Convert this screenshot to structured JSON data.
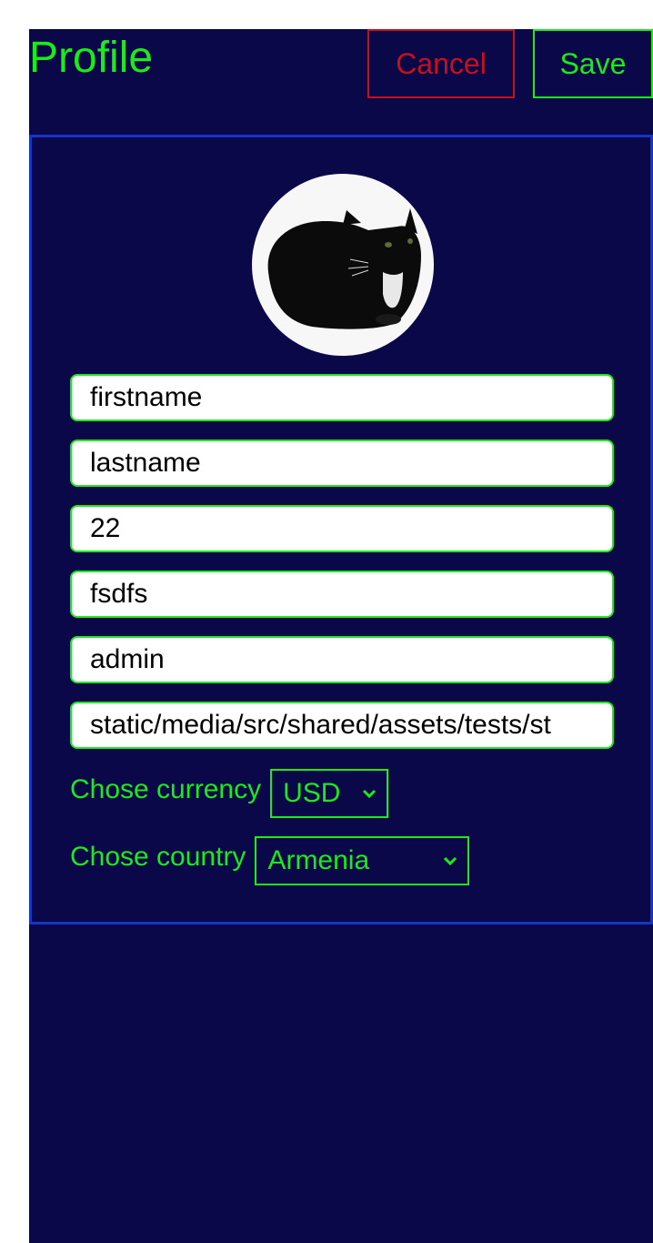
{
  "header": {
    "title": "Profile",
    "cancel_label": "Cancel",
    "save_label": "Save"
  },
  "profile": {
    "avatar_icon": "cat-photo-avatar",
    "fields": [
      {
        "name": "firstname",
        "value": "firstname"
      },
      {
        "name": "lastname",
        "value": "lastname"
      },
      {
        "name": "age",
        "value": "22"
      },
      {
        "name": "username",
        "value": "fsdfs"
      },
      {
        "name": "role",
        "value": "admin"
      },
      {
        "name": "image-path",
        "value": "static/media/src/shared/assets/tests/st"
      }
    ],
    "currency": {
      "label": "Chose currency",
      "selected": "USD"
    },
    "country": {
      "label": "Chose country",
      "selected": "Armenia"
    }
  },
  "colors": {
    "background": "#0a0849",
    "accent": "#1bea1b",
    "danger": "#c8101b",
    "card_border": "#1535c8"
  }
}
